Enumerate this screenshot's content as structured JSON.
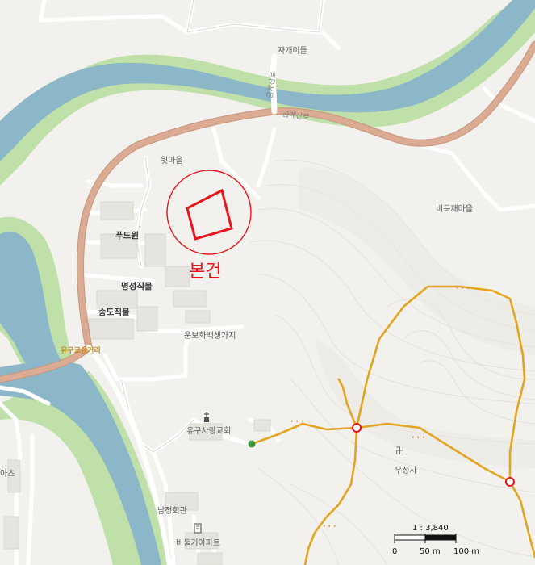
{
  "map": {
    "colors": {
      "land": "#f2f1ed",
      "river": "#8cb7c8",
      "riverbank": "#bfe0a8",
      "road_main": "#d9a890",
      "trail": "#e3a41f",
      "marker": "#e8141b"
    },
    "place_labels": {
      "jagaemideul": "자개미들",
      "witmaeul": "윗마을",
      "biteukjaemaeul": "비득재마을",
      "pudeuwon": "푸드원",
      "myeongseong": "명성직물",
      "songdo": "송도직물",
      "unbohwa": "운보화백생가지",
      "church": "유구사랑교회",
      "temple": "우정사",
      "hall": "남정회관",
      "apt": "비둘기아파트",
      "left_edge": "아츠"
    },
    "road_labels": {
      "upper_road": "금계산로",
      "bridge_road": "금계산로",
      "junction": "유구교삼거리"
    },
    "subject": {
      "label": "본건",
      "icon": "target-circle"
    },
    "scale": {
      "ratio": "1 : 3,840",
      "ticks": [
        "0",
        "50 m",
        "100 m"
      ]
    }
  }
}
